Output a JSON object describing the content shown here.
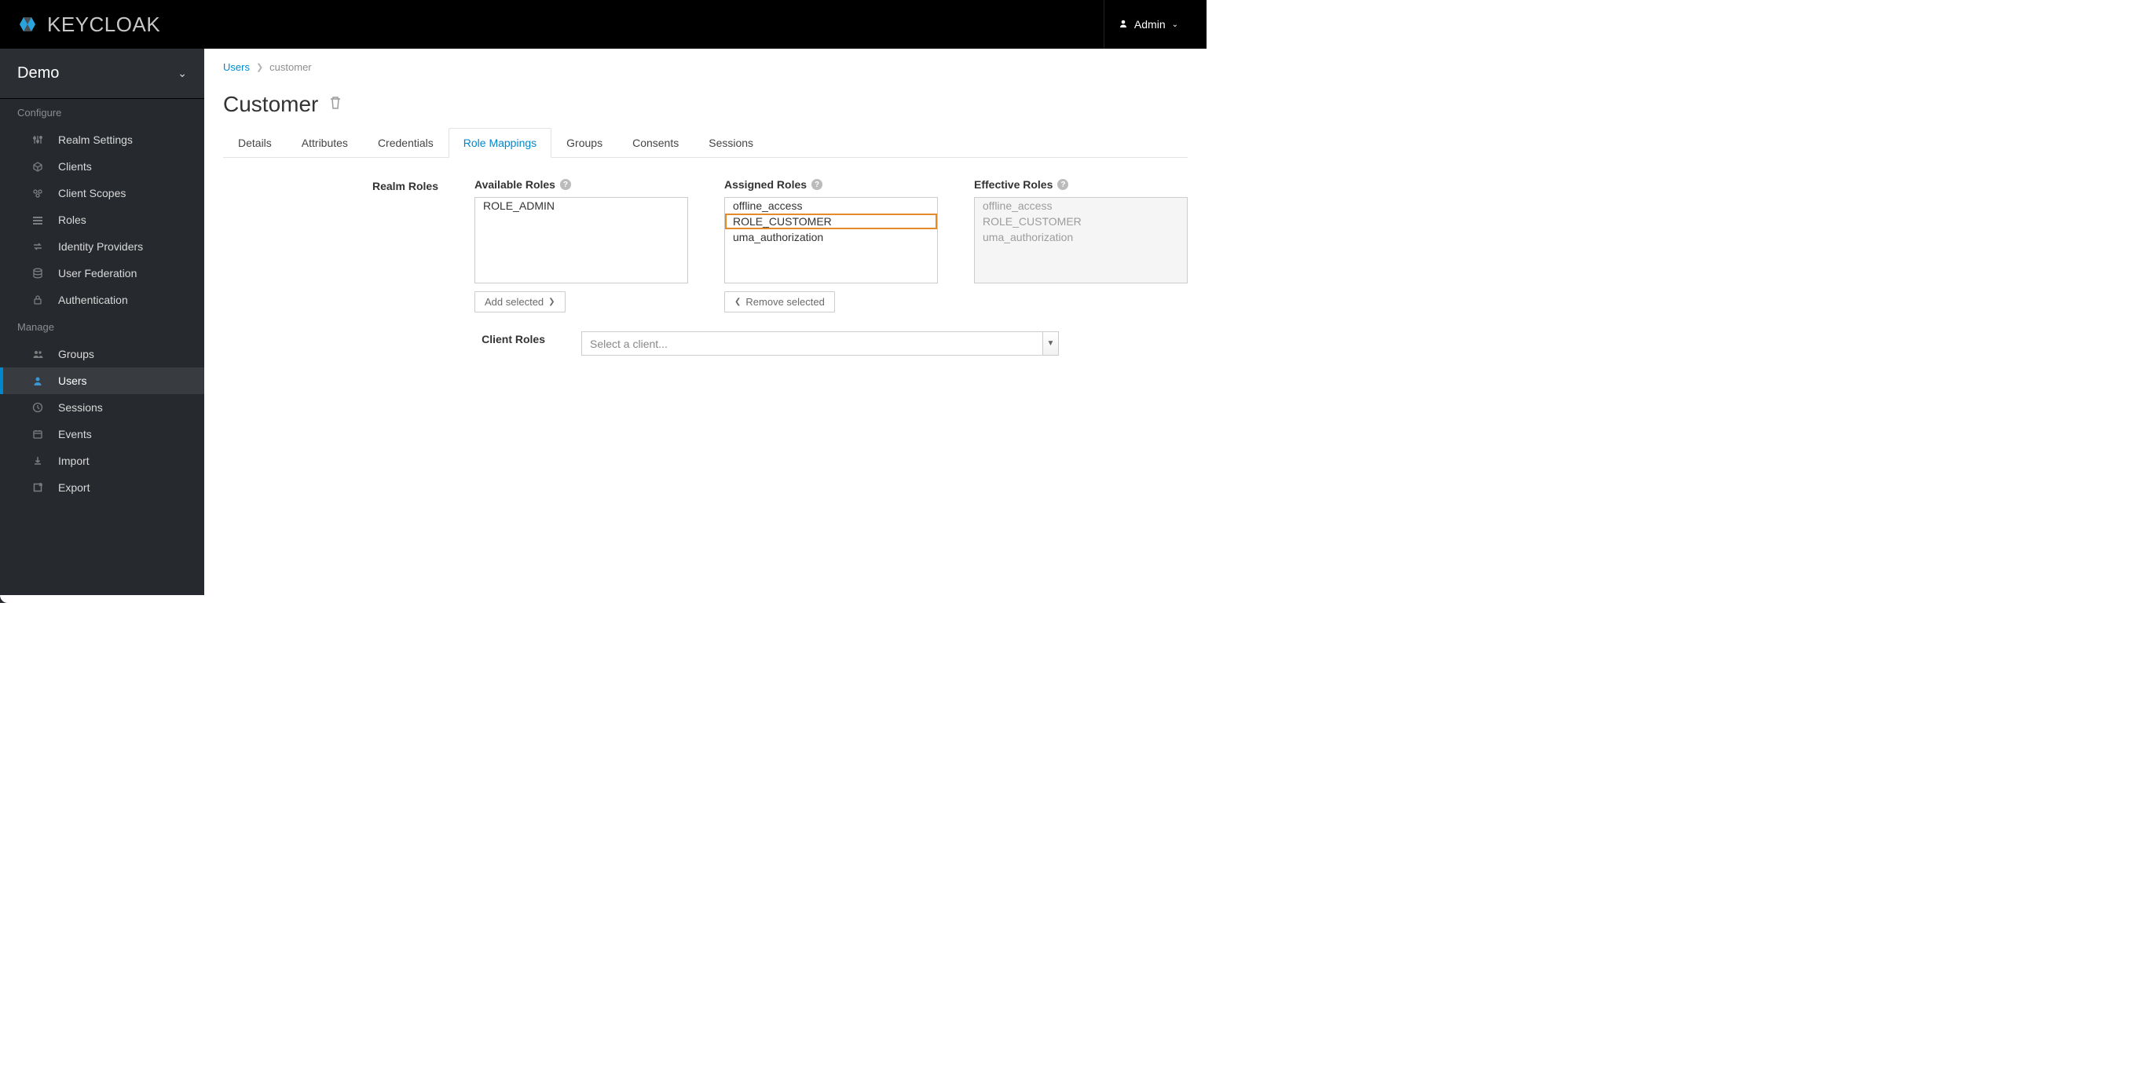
{
  "header": {
    "brand_text": "KEYCLOAK",
    "user_label": "Admin"
  },
  "sidebar": {
    "realm": "Demo",
    "sections": [
      {
        "title": "Configure",
        "items": [
          {
            "id": "realm-settings",
            "label": "Realm Settings"
          },
          {
            "id": "clients",
            "label": "Clients"
          },
          {
            "id": "client-scopes",
            "label": "Client Scopes"
          },
          {
            "id": "roles",
            "label": "Roles"
          },
          {
            "id": "identity-providers",
            "label": "Identity Providers"
          },
          {
            "id": "user-federation",
            "label": "User Federation"
          },
          {
            "id": "authentication",
            "label": "Authentication"
          }
        ]
      },
      {
        "title": "Manage",
        "items": [
          {
            "id": "groups",
            "label": "Groups"
          },
          {
            "id": "users",
            "label": "Users",
            "active": true
          },
          {
            "id": "sessions",
            "label": "Sessions"
          },
          {
            "id": "events",
            "label": "Events"
          },
          {
            "id": "import",
            "label": "Import"
          },
          {
            "id": "export",
            "label": "Export"
          }
        ]
      }
    ]
  },
  "breadcrumbs": {
    "root": "Users",
    "current": "customer"
  },
  "page": {
    "title": "Customer"
  },
  "tabs": [
    {
      "label": "Details"
    },
    {
      "label": "Attributes"
    },
    {
      "label": "Credentials"
    },
    {
      "label": "Role Mappings",
      "active": true
    },
    {
      "label": "Groups"
    },
    {
      "label": "Consents"
    },
    {
      "label": "Sessions"
    }
  ],
  "roles": {
    "realm_label": "Realm Roles",
    "available_label": "Available Roles",
    "assigned_label": "Assigned Roles",
    "effective_label": "Effective Roles",
    "available": [
      "ROLE_ADMIN"
    ],
    "assigned": [
      "offline_access",
      "ROLE_CUSTOMER",
      "uma_authorization"
    ],
    "assigned_highlight": "ROLE_CUSTOMER",
    "effective": [
      "offline_access",
      "ROLE_CUSTOMER",
      "uma_authorization"
    ],
    "add_btn": "Add selected",
    "remove_btn": "Remove selected",
    "client_label": "Client Roles",
    "client_placeholder": "Select a client..."
  }
}
